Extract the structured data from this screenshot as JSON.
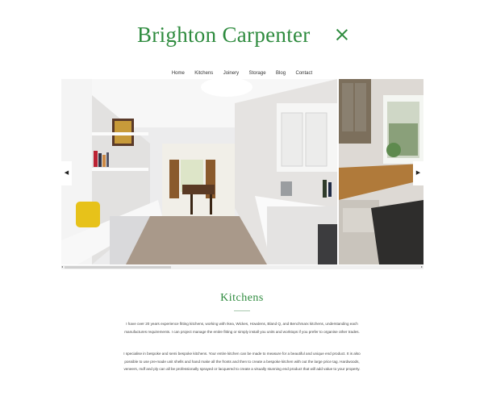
{
  "brand": {
    "title": "Brighton Carpenter"
  },
  "nav": {
    "items": [
      "Home",
      "Kitchens",
      "Joinery",
      "Storage",
      "Blog",
      "Contact"
    ]
  },
  "gallery": {
    "prev_label": "◀",
    "next_label": "▶",
    "scroll_left": "◂",
    "scroll_right": "▸"
  },
  "section": {
    "title": "Kitchens",
    "paragraphs": [
      "I have over 20 years experience fitting kitchens, working with Ikea, Wickes, Howdens, Bland Q, and Benchmarx kitchens, understanding each manufactures requirements. I can project manage the entire fitting or simply install you units and worktops if you prefer to organise other trades.",
      "I specialise in bespoke and semi bespoke kitchens. Your entire kitchen can be made to measure for a beautiful and unique end product. It is also possible to use pre-made unit shells and hand make all the fronts and then to create a bespoke kitchen with out the large price tag. Hardwoods, veneers, mdf and ply can all be professionally sprayed or lacquered to create a visually stunning end product that will add value to your property."
    ]
  },
  "colors": {
    "accent": "#2e8b3e"
  }
}
